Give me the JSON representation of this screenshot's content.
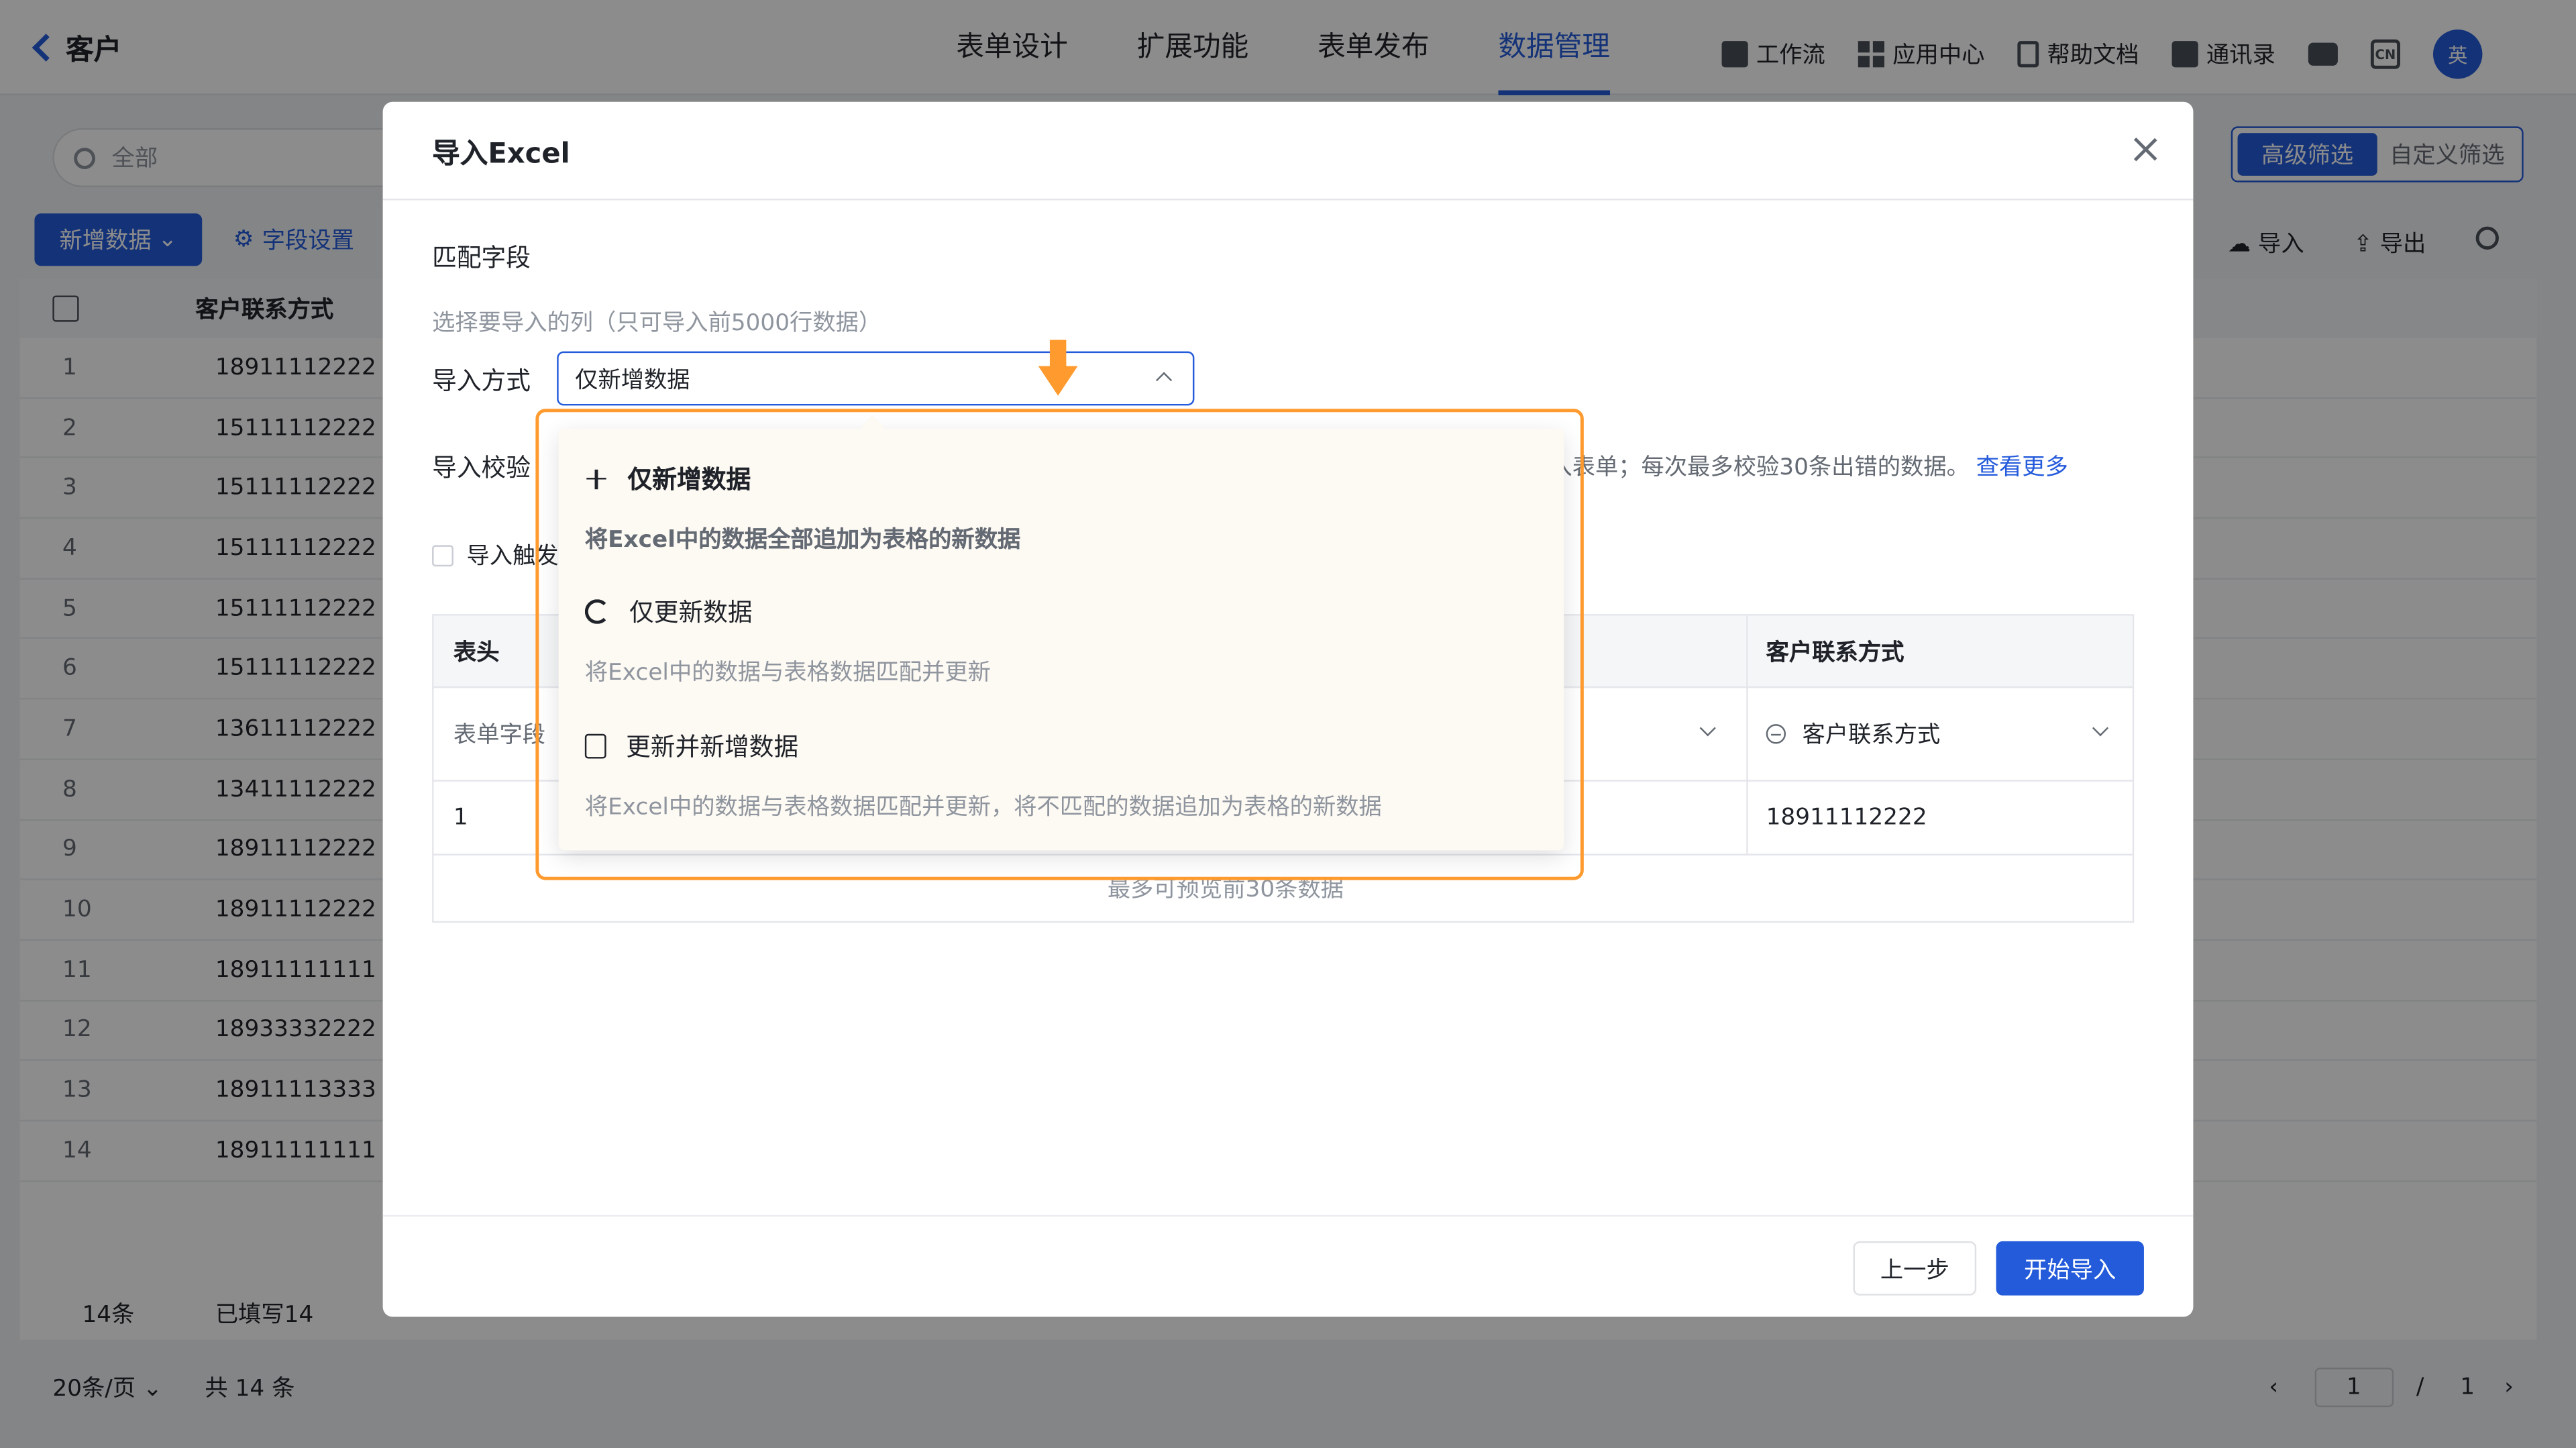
{
  "app": {
    "title": "客户"
  },
  "nav": {
    "tabs": [
      "表单设计",
      "扩展功能",
      "表单发布",
      "数据管理"
    ],
    "active_index": 3
  },
  "tools": [
    {
      "label": "工作流",
      "icon": "workflow-icon"
    },
    {
      "label": "应用中心",
      "icon": "app-grid-icon"
    },
    {
      "label": "帮助文档",
      "icon": "doc-icon"
    },
    {
      "label": "通讯录",
      "icon": "contacts-icon"
    }
  ],
  "user": {
    "avatar_text": "英"
  },
  "background": {
    "search_placeholder": "全部",
    "new_button": "新增数据",
    "field_settings": "字段设置",
    "filter_advanced": "高级筛选",
    "filter_custom": "自定义筛选",
    "import_label": "导入",
    "export_label": "导出",
    "column_header": "客户联系方式",
    "rows": [
      {
        "idx": "1",
        "tel": "18911112222"
      },
      {
        "idx": "2",
        "tel": "15111112222"
      },
      {
        "idx": "3",
        "tel": "15111112222"
      },
      {
        "idx": "4",
        "tel": "15111112222"
      },
      {
        "idx": "5",
        "tel": "15111112222"
      },
      {
        "idx": "6",
        "tel": "15111112222"
      },
      {
        "idx": "7",
        "tel": "13611112222"
      },
      {
        "idx": "8",
        "tel": "13411112222"
      },
      {
        "idx": "9",
        "tel": "18911112222"
      },
      {
        "idx": "10",
        "tel": "18911112222"
      },
      {
        "idx": "11",
        "tel": "18911111111"
      },
      {
        "idx": "12",
        "tel": "18933332222"
      },
      {
        "idx": "13",
        "tel": "18911113333"
      },
      {
        "idx": "14",
        "tel": "18911111111"
      }
    ],
    "footer_count": "14条",
    "footer_filled": "已填写14",
    "page_size": "20条/页",
    "total": "共 14 条",
    "page_current": "1",
    "page_sep": "/",
    "page_total": "1"
  },
  "modal": {
    "title": "导入Excel",
    "section_title": "匹配字段",
    "hint": "选择要导入的列（只可导入前5000行数据）",
    "import_mode_label": "导入方式",
    "import_mode_value": "仅新增数据",
    "verify_label": "导入校验",
    "verify_tail": "入表单；每次最多校验30条出错的数据。",
    "verify_more": "查看更多",
    "trigger_label": "导入触发",
    "table": {
      "header_label": "表头",
      "header_right": "客户联系方式",
      "field_label": "表单字段",
      "field_right": "客户联系方式",
      "data_left": "1",
      "data_right": "18911112222"
    },
    "preview_note": "最多可预览前30条数据",
    "prev_button": "上一步",
    "start_button": "开始导入"
  },
  "dropdown": {
    "options": [
      {
        "title": "仅新增数据",
        "desc": "将Excel中的数据全部追加为表格的新数据",
        "icon": "plus-icon",
        "selected": true
      },
      {
        "title": "仅更新数据",
        "desc": "将Excel中的数据与表格数据匹配并更新",
        "icon": "sync-icon",
        "selected": false
      },
      {
        "title": "更新并新增数据",
        "desc": "将Excel中的数据与表格数据匹配并更新，将不匹配的数据追加为表格的新数据",
        "icon": "note-icon",
        "selected": false
      }
    ]
  },
  "colors": {
    "accent": "#245bdb",
    "highlight": "#ff9a2e"
  }
}
